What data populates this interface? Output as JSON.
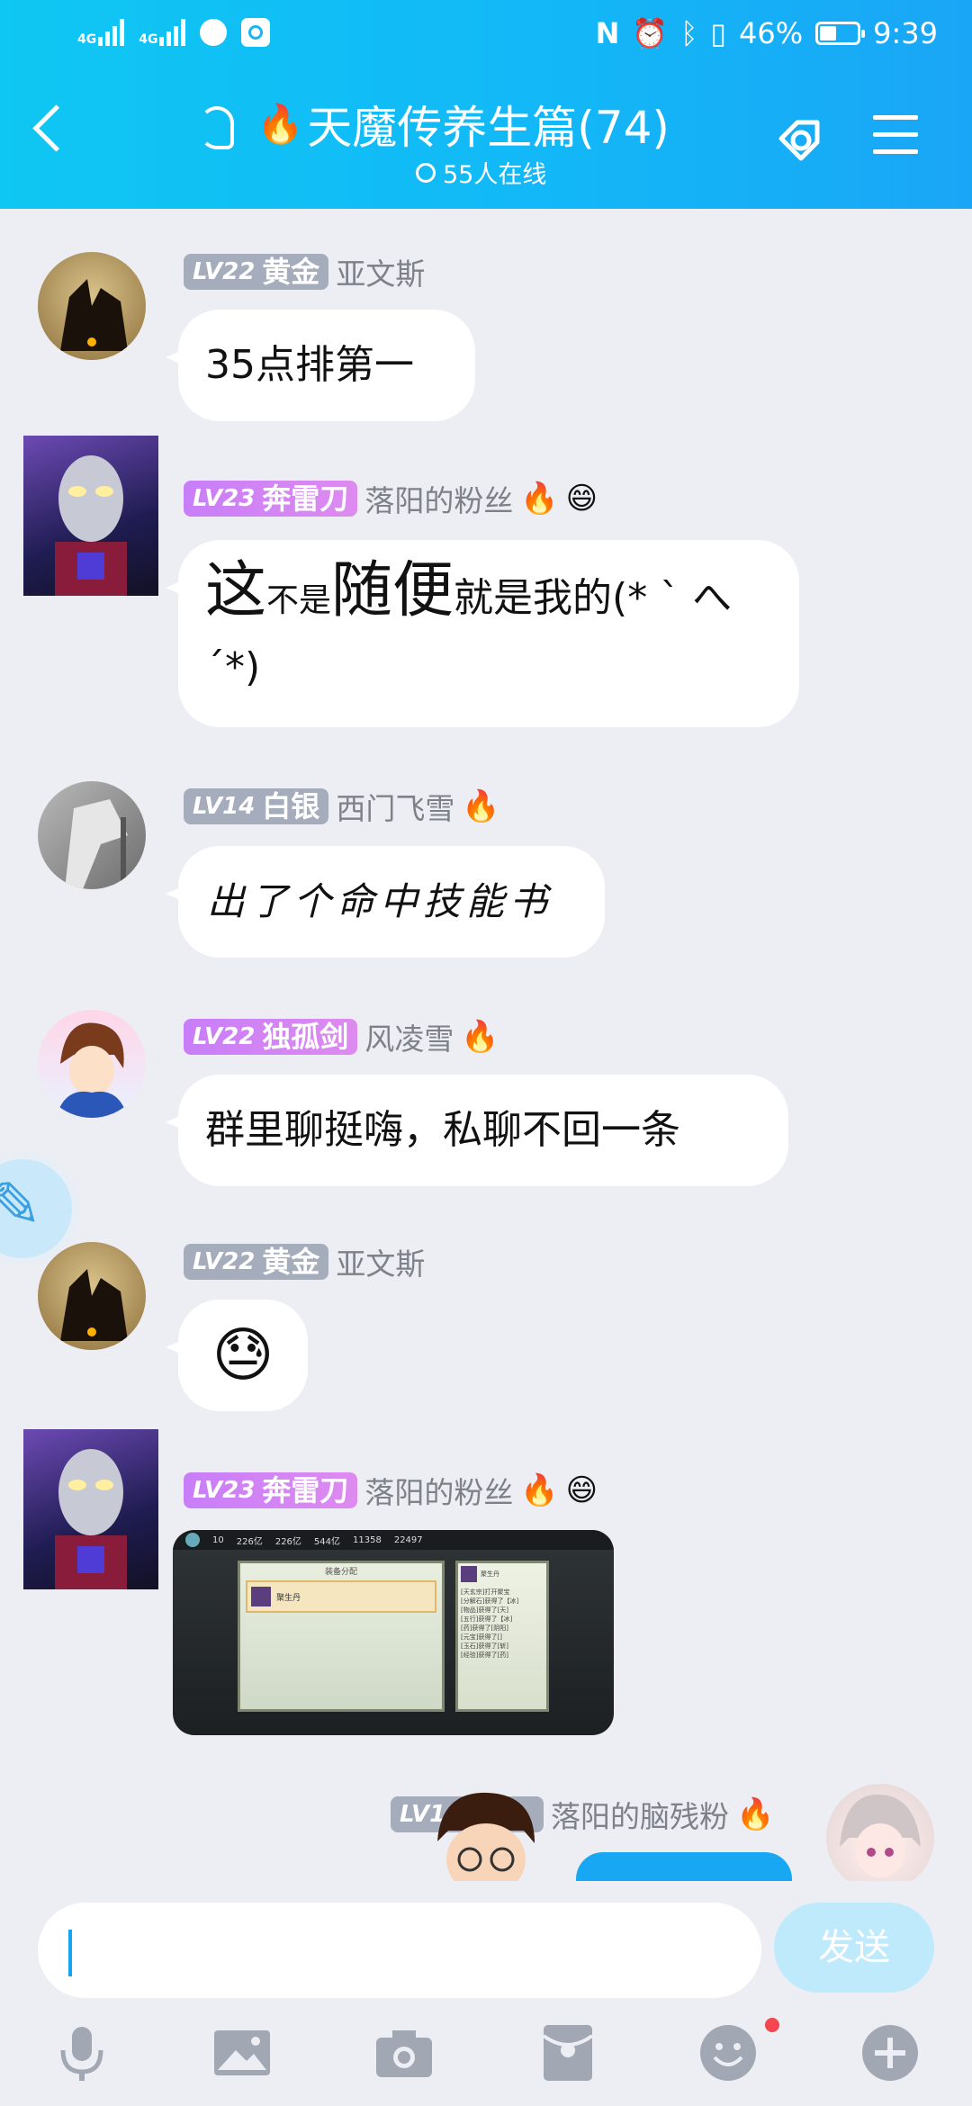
{
  "status_bar": {
    "net1": "4G",
    "net2": "4G",
    "battery": "46%",
    "battery_level": 0.46,
    "time": "9:39"
  },
  "header": {
    "title": "天魔传养生篇(74)",
    "online": "55人在线"
  },
  "messages": [
    {
      "level": "LV22",
      "title": "黄金",
      "nick": "亚文斯",
      "text": "35点排第一"
    },
    {
      "level": "LV23",
      "title": "奔雷刀",
      "nick": "落阳的粉丝",
      "text_parts": [
        "这",
        "不是",
        "随便",
        "就是我的(* ` へ ´*)"
      ]
    },
    {
      "level": "LV14",
      "title": "白银",
      "nick": "西门飞雪",
      "text": "出了个命中技能书"
    },
    {
      "level": "LV22",
      "title": "独孤剑",
      "nick": "风凌雪",
      "text": "群里聊挺嗨，私聊不回一条"
    },
    {
      "level": "LV22",
      "title": "黄金",
      "nick": "亚文斯",
      "emoji": "😓"
    },
    {
      "level": "LV23",
      "title": "奔雷刀",
      "nick": "落阳的粉丝",
      "image_label": "screenshot"
    },
    {
      "level": "LV1",
      "nick": "落阳的脑残粉"
    }
  ],
  "input": {
    "value": "",
    "send_label": "发送"
  },
  "toolbar": [
    "mic-icon",
    "image-icon",
    "camera-icon",
    "redpacket-icon",
    "emoji-icon",
    "plus-icon"
  ],
  "game_image": {
    "stats": [
      "10",
      "226亿",
      "226亿",
      "544亿",
      "11358",
      "22497"
    ],
    "panel_title": "装备分配",
    "item_name": "聚生丹",
    "right_title": "聚生丹",
    "right_lines": [
      "[天玄宗]打开聚宝",
      "[分解石]获得了【冰]",
      "[物品]获得了[天]",
      "[五行]获得了【冰]",
      "[药]获得了[阴阳]",
      "[元宝]获得了[]",
      "[玉石]获得了[斩]",
      "[经验]获得了[药]"
    ]
  }
}
